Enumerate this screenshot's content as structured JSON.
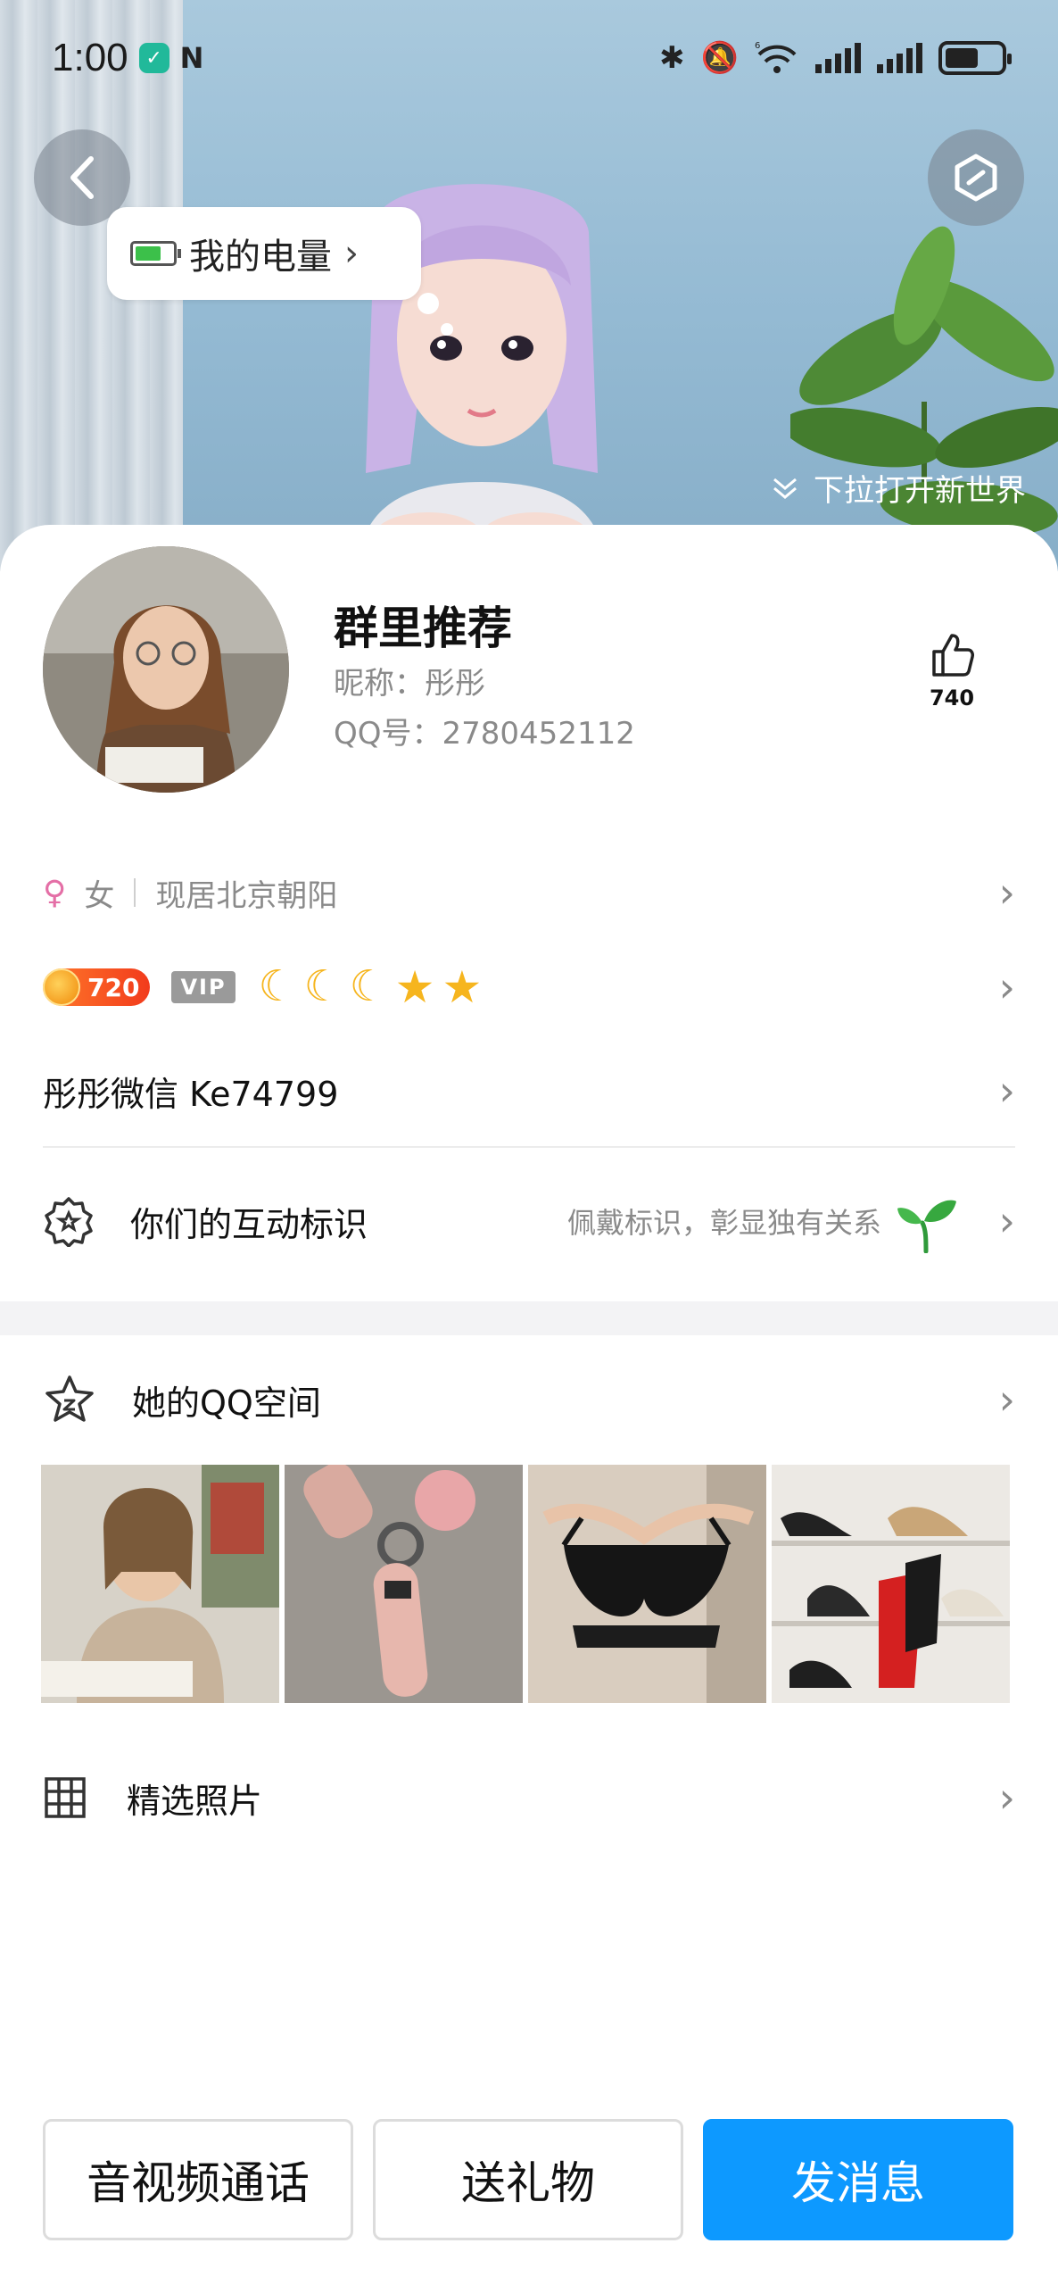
{
  "status_bar": {
    "time": "1:00",
    "nfc_label": "N",
    "network_label": "6"
  },
  "hero": {
    "energy_label": "我的电量",
    "pull_hint": "下拉打开新世界"
  },
  "profile": {
    "title": "群里推荐",
    "nickname": "昵称：彤彤",
    "qq": "QQ号：2780452112",
    "like_count": "740"
  },
  "info": {
    "gender": "女",
    "location": "现居北京朝阳",
    "level": "720",
    "vip": "VIP",
    "wechat": "彤彤微信 Ke74799"
  },
  "interaction": {
    "title": "你们的互动标识",
    "subtitle": "佩戴标识，彰显独有关系"
  },
  "qzone": {
    "title": "她的QQ空间"
  },
  "featured": {
    "title": "精选照片"
  },
  "actions": {
    "call": "音视频通话",
    "gift": "送礼物",
    "message": "发消息"
  },
  "colors": {
    "primary": "#0d99ff",
    "level_badge": "#f23b1c",
    "gender": "#e46fa6",
    "star": "#f6b51e"
  }
}
